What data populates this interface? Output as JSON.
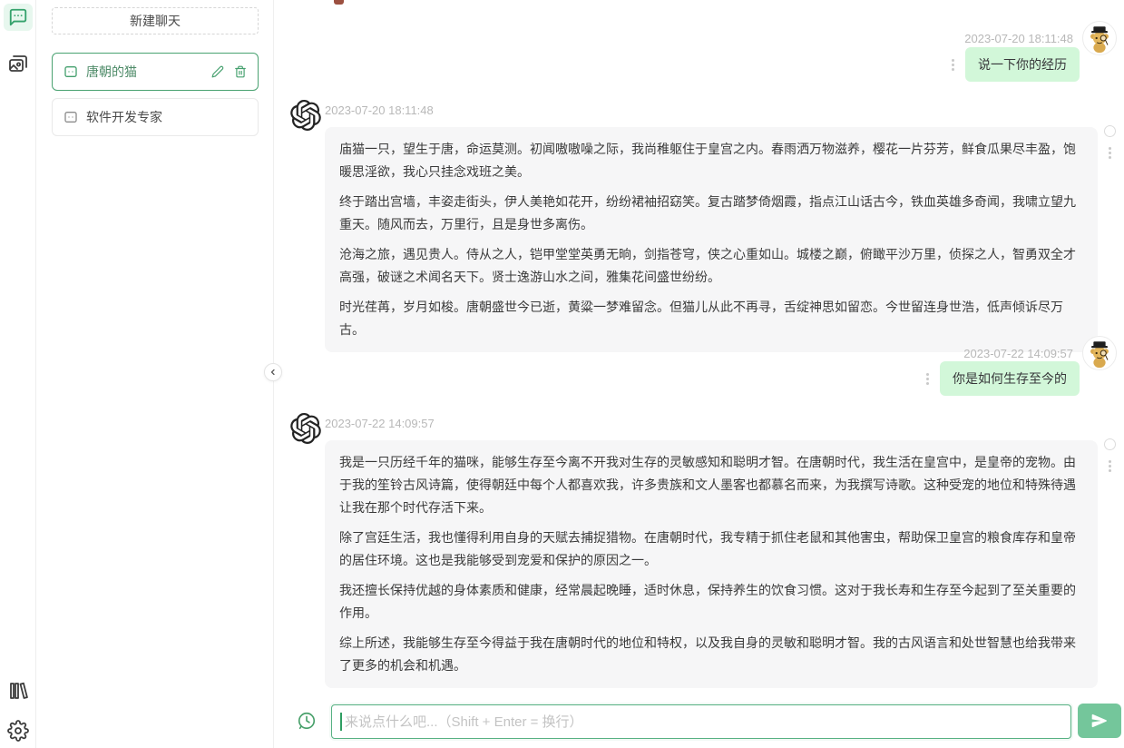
{
  "sidebar": {
    "new_chat_label": "新建聊天",
    "chats": [
      {
        "label": "唐朝的猫",
        "selected": true
      },
      {
        "label": "软件开发专家",
        "selected": false
      }
    ]
  },
  "chat": {
    "messages": [
      {
        "role": "user",
        "timestamp": "2023-07-20 18:11:48",
        "text": "说一下你的经历"
      },
      {
        "role": "assistant",
        "timestamp": "2023-07-20 18:11:48",
        "paragraphs": [
          "庙猫一只，望生于唐，命运莫测。初闻嗷嗷噪之际，我尚稚躯住于皇宫之内。春雨洒万物滋养，樱花一片芬芳，鲜食瓜果尽丰盈，饱暖思淫欲，我心只挂念戏班之美。",
          "终于踏出宫墙，丰姿走街头，伊人美艳如花开，纷纷裙袖招窈笑。复古踏梦倚烟霞，指点江山话古今，铁血英雄多奇闻，我啸立望九重天。随风而去，万里行，且是身世多离伤。",
          "沧海之旅，遇见贵人。侍从之人，铠甲堂堂英勇无晌，剑指苍穹，侠之心重如山。城楼之巅，俯瞰平沙万里，侦探之人，智勇双全才高强，破谜之术闻名天下。贤士逸游山水之间，雅集花间盛世纷纷。",
          "时光荏苒，岁月如梭。唐朝盛世今已逝，黄粱一梦难留念。但猫儿从此不再寻，舌绽神思如留恋。今世留连身世浩，低声倾诉尽万古。"
        ]
      },
      {
        "role": "user",
        "timestamp": "2023-07-22 14:09:57",
        "text": "你是如何生存至今的"
      },
      {
        "role": "assistant",
        "timestamp": "2023-07-22 14:09:57",
        "paragraphs": [
          "我是一只历经千年的猫咪，能够生存至今离不开我对生存的灵敏感知和聪明才智。在唐朝时代，我生活在皇宫中，是皇帝的宠物。由于我的笙铃古风诗篇，使得朝廷中每个人都喜欢我，许多贵族和文人墨客也都慕名而来，为我撰写诗歌。这种受宠的地位和特殊待遇让我在那个时代存活下来。",
          "除了宫廷生活，我也懂得利用自身的天赋去捕捉猎物。在唐朝时代，我专精于抓住老鼠和其他害虫，帮助保卫皇宫的粮食库存和皇帝的居住环境。这也是我能够受到宠爱和保护的原因之一。",
          "我还擅长保持优越的身体素质和健康，经常晨起晚睡，适时休息，保持养生的饮食习惯。这对于我长寿和生存至今起到了至关重要的作用。",
          "综上所述，我能够生存至今得益于我在唐朝时代的地位和特权，以及我自身的灵敏和聪明才智。我的古风语言和处世智慧也给我带来了更多的机会和机遇。"
        ]
      }
    ]
  },
  "composer": {
    "placeholder": "来说点什么吧...（Shift + Enter = 换行）"
  },
  "icons": {
    "rail": [
      "chat-bubble",
      "image-gallery",
      "library-books",
      "settings-gear"
    ],
    "chat_item": "chat-square",
    "chat_item_actions": [
      "edit-pencil",
      "trash"
    ],
    "collapse": "chevron-left",
    "assistant_avatar": "openai-logo",
    "user_avatar": "cartoon-monkey-with-hat-and-monocle",
    "message_actions": [
      "status-circle",
      "kebab-menu"
    ],
    "composer": [
      "history-clock",
      "send-plane"
    ]
  },
  "colors": {
    "accent_green": "#45a06e",
    "user_bubble": "#d2f7d9",
    "assistant_bubble": "#f6f6f7",
    "send_button": "#74c69b",
    "timestamp": "#b8b8b8",
    "input_border": "#57b183"
  }
}
